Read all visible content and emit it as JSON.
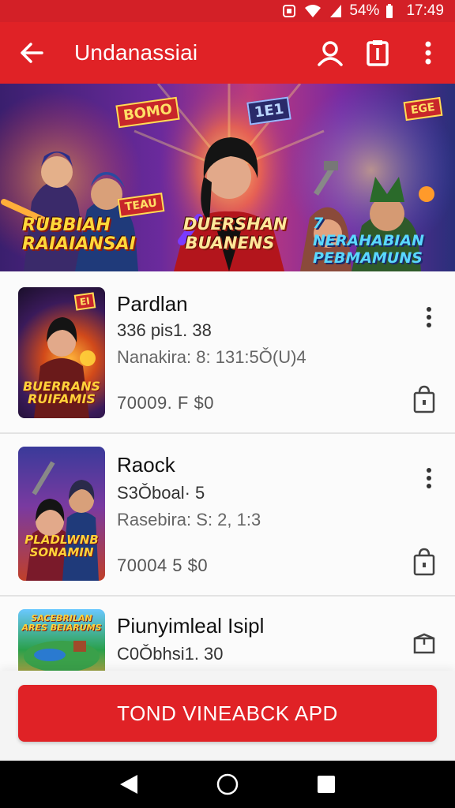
{
  "status_bar": {
    "battery": "54%",
    "time": "17:49",
    "icons": [
      "notification-icon",
      "wifi-icon",
      "signal-icon",
      "battery-icon"
    ]
  },
  "app_bar": {
    "title": "Undanassiai",
    "icons": [
      "back-arrow-icon",
      "account-icon",
      "clipboard-icon",
      "more-vert-icon"
    ]
  },
  "banner": {
    "left_title": "RUBBIAH RAIAIANSAI",
    "left_badge_top": "BOMO",
    "left_badge_bottom": "TEAU",
    "center_title": "DUERSHAN BUANENS",
    "center_badge": "1E1",
    "right_title": "7 NERAHABIAN PEBMAMUNS",
    "right_badge": "EGE"
  },
  "games": [
    {
      "name": "Pardlan",
      "line1": "336 pis1. 38",
      "line2": "Nanakira: 8: 131:5Ǒ(U)4",
      "price": "70009. F  $0",
      "thumb_caption": "BUERRANS RUIFAMIS",
      "thumb_badge": "EI"
    },
    {
      "name": "Raock",
      "line1": "S3Ǒboal· 5",
      "line2": "Rasebira: S: 2, 1:3",
      "price": "70004  5  $0",
      "thumb_caption": "PLADLWNB SONAMIN"
    },
    {
      "name": "Piunyimleal Isipl",
      "line1": "C0Ǒbhsi1. 30",
      "thumb_caption": "SACEBRILAN ARES BEIARUMS"
    }
  ],
  "cta": {
    "label": "TOND VINEABCK APD"
  },
  "nav_bar": {
    "icons": [
      "nav-back-icon",
      "nav-home-icon",
      "nav-recents-icon"
    ]
  },
  "colors": {
    "primary": "#e02226",
    "status": "#d32027",
    "background": "#f6f6f6"
  }
}
